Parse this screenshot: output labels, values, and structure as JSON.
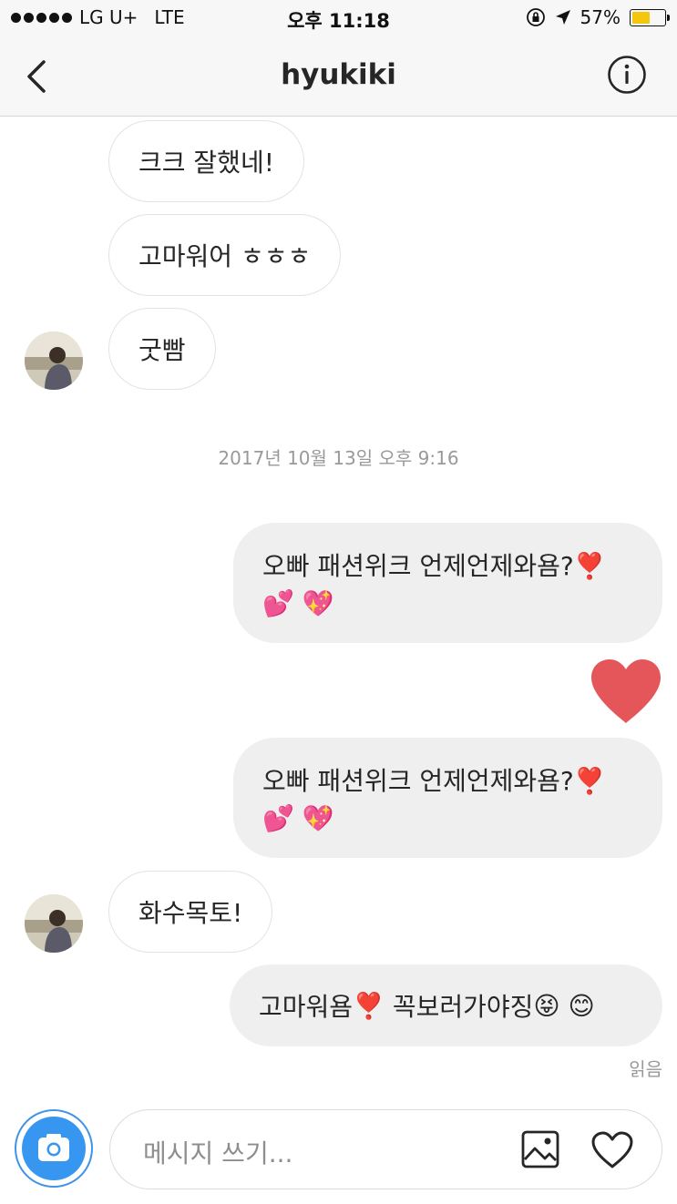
{
  "status_bar": {
    "carrier": "LG U+",
    "network": "LTE",
    "time": "오후 11:18",
    "battery": "57%",
    "battery_level": 0.57
  },
  "header": {
    "title": "hyukiki"
  },
  "messages": {
    "m1": "크크 잘했네!",
    "m2": "고마워어 ㅎㅎㅎ",
    "m3": "굿빰",
    "timestamp": "2017년 10월 13일 오후 9:16",
    "m4_line1": "오빠 패션위크 언제언제와욤?",
    "m4_emoji1": "❣️",
    "m4_line2": "💕 💖",
    "m5_line1": "오빠 패션위크 언제언제와욤?",
    "m5_emoji1": "❣️",
    "m5_line2": "💕 💖",
    "m6": "화수목토!",
    "m7_part1": "고마워욤",
    "m7_emoji1": "❣️",
    "m7_part2": "꼭보러가야징",
    "m7_emoji2": "😝 😊",
    "seen": "읽음"
  },
  "composer": {
    "placeholder": "메시지 쓰기..."
  },
  "colors": {
    "accent": "#3797f0",
    "heart": "#e4565a",
    "battery": "#f4c70e"
  },
  "icons": [
    "back-icon",
    "info-icon",
    "camera-icon",
    "gallery-icon",
    "heart-icon",
    "location-arrow-icon",
    "rotation-lock-icon"
  ]
}
